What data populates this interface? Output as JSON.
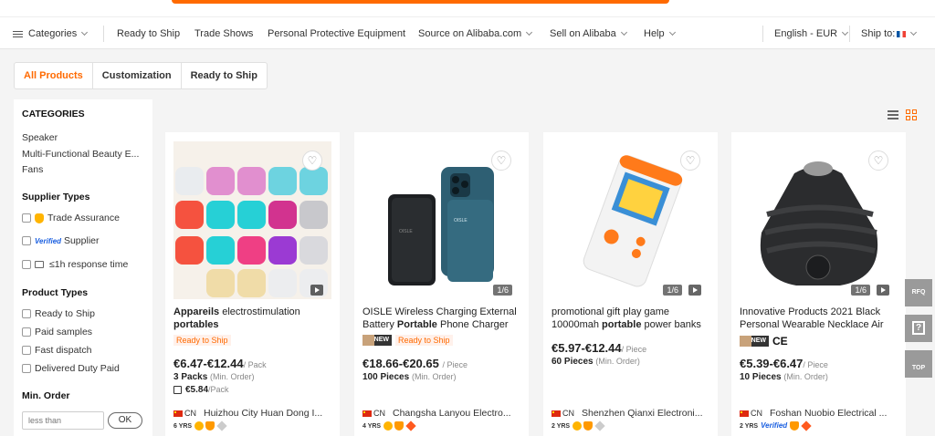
{
  "nav": {
    "categories": "Categories",
    "ready_to_ship": "Ready to Ship",
    "trade_shows": "Trade Shows",
    "ppe": "Personal Protective Equipment",
    "source": "Source on Alibaba.com",
    "sell": "Sell on Alibaba",
    "help": "Help",
    "language": "English - EUR",
    "ship_to": "Ship to:"
  },
  "tabs": [
    "All Products",
    "Customization",
    "Ready to Ship"
  ],
  "sidebar": {
    "categories_heading": "CATEGORIES",
    "categories": [
      "Speaker",
      "Multi-Functional Beauty E...",
      "Fans"
    ],
    "supplier_types_heading": "Supplier Types",
    "supplier_types": [
      "Trade Assurance",
      "Verified",
      "Supplier",
      "≤1h response time"
    ],
    "product_types_heading": "Product Types",
    "product_types": [
      "Ready to Ship",
      "Paid samples",
      "Fast dispatch",
      "Delivered Duty Paid"
    ],
    "min_order_heading": "Min. Order",
    "min_order_placeholder": "less than",
    "ok_label": "OK"
  },
  "products": [
    {
      "title_a": "Appareils",
      "title_b": " electrostimulation",
      "title_c": "portables",
      "title_d": "",
      "tag": "Ready to Ship",
      "price": "€6.47-€12.44",
      "unit": "/ Pack",
      "moq": "3 Packs",
      "moq_label": "(Min. Order)",
      "per_piece": "€5.84",
      "per_piece_unit": "/Pack",
      "country": "CN",
      "supplier": "Huizhou City Huan Dong I...",
      "years": "6 YRS"
    },
    {
      "title_a": "OISLE Wireless Charging External Battery ",
      "title_b": "Portable",
      "title_c": " Phone Charger For",
      "tag_new": "NEW",
      "tag": "Ready to Ship",
      "counter": "1/6",
      "price": "€18.66-€20.65",
      "unit": "/ Piece",
      "moq": "100 Pieces",
      "moq_label": "(Min. Order)",
      "country": "CN",
      "supplier": "Changsha Lanyou Electro...",
      "years": "4 YRS"
    },
    {
      "title_a": "promotional gift play game 10000mah ",
      "title_b": "portable",
      "title_c": " power banks",
      "counter": "1/6",
      "price": "€5.97-€12.44",
      "unit": "/ Piece",
      "moq": "60 Pieces",
      "moq_label": "(Min. Order)",
      "country": "CN",
      "supplier": "Shenzhen Qianxi Electroni...",
      "years": "2 YRS"
    },
    {
      "title_a": "Innovative Products 2021 Black Personal Wearable Necklace Air",
      "tag_new": "NEW",
      "ce": "CE",
      "counter": "1/6",
      "price": "€5.39-€6.47",
      "unit": "/ Piece",
      "moq": "10 Pieces",
      "moq_label": "(Min. Order)",
      "country": "CN",
      "supplier": "Foshan Nuobio Electrical ...",
      "years": "2 YRS",
      "verified": "Verified"
    }
  ],
  "float": {
    "rfq": "RFQ",
    "top": "TOP"
  },
  "colors": {
    "accent": "#ff6a00",
    "ready_bg": "#fff1eb",
    "float_bg": "#9a9a9a"
  }
}
